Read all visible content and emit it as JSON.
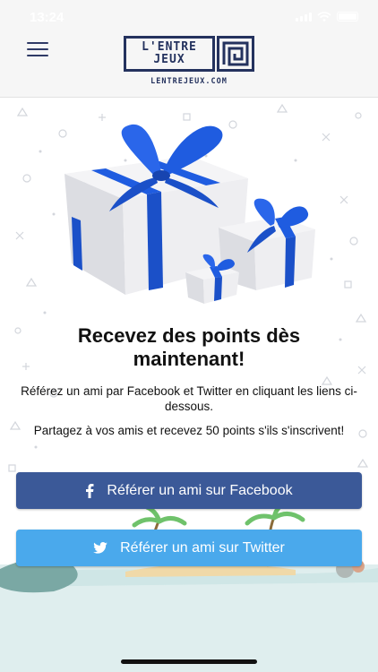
{
  "status_bar": {
    "time": "13:24"
  },
  "header": {
    "menu_icon": "hamburger-menu-icon",
    "logo": {
      "line1": "L'ENTRE",
      "line2": "JEUX",
      "url": "LENTREJEUX.COM"
    }
  },
  "hero": {
    "image": "gift-boxes-illustration"
  },
  "content": {
    "title": "Recevez des points dès maintenant!",
    "description1": "Référez un ami par Facebook et Twitter en cliquant les liens ci-dessous.",
    "description2": "Partagez à vos amis et recevez 50 points s'ils s'inscrivent!"
  },
  "buttons": {
    "facebook": {
      "label": "Référer un ami sur Facebook",
      "icon": "facebook-icon",
      "color": "#3b5998"
    },
    "twitter": {
      "label": "Référer un ami sur Twitter",
      "icon": "twitter-icon",
      "color": "#4aa9ec"
    }
  },
  "colors": {
    "brand_navy": "#24325e",
    "gift_ribbon": "#1f5ce0"
  }
}
